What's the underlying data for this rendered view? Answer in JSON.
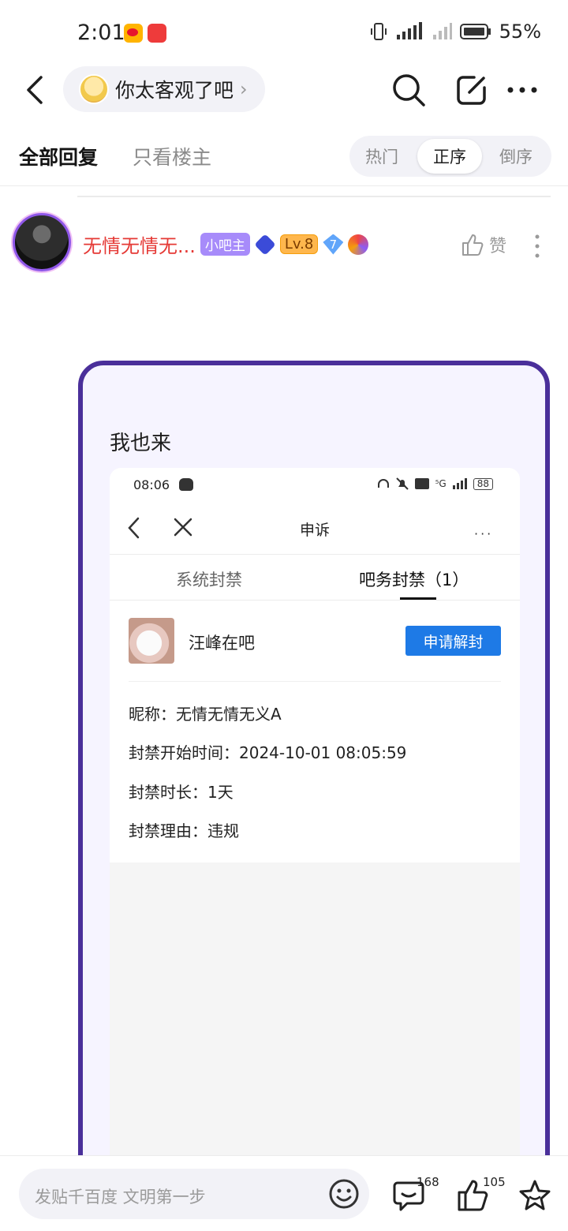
{
  "status_bar": {
    "time": "2:01",
    "battery": "55%"
  },
  "header": {
    "forum_name": "你太客观了吧",
    "chevron": "›"
  },
  "tabs": {
    "all_replies": "全部回复",
    "only_op": "只看楼主",
    "sort": [
      "热门",
      "正序",
      "倒序"
    ],
    "sort_active": "正序"
  },
  "post": {
    "username": "无情无情无...",
    "badge_mod": "小吧主",
    "badge_level": "Lv.8",
    "badge_gem_number": "7",
    "like_label": "赞",
    "text": "我也来"
  },
  "embedded": {
    "time": "08:06",
    "network": "⁵G",
    "battery": "88",
    "title": "申诉",
    "more": "···",
    "tab_system": "系统封禁",
    "tab_bar": "吧务封禁（1）",
    "bar_name": "汪峰在吧",
    "apply_button": "申请解封",
    "info": [
      "昵称：无情无情无义A",
      "封禁开始时间：2024-10-01 08:05:59",
      "封禁时长：1天",
      "封禁理由：违规"
    ]
  },
  "bottom": {
    "placeholder": "发贴千百度 文明第一步",
    "comment_count": "168",
    "like_count": "105"
  },
  "colors": {
    "username": "#e53935",
    "card_border": "#4a2f9a",
    "apply_button": "#1e7ae6",
    "mod_badge": "#a78bfa"
  },
  "icons": [
    "back-icon",
    "search-icon",
    "edit-icon",
    "more-icon",
    "thumb-up-icon",
    "vertical-more-icon",
    "emoji-icon",
    "comment-icon",
    "star-icon",
    "close-icon"
  ]
}
